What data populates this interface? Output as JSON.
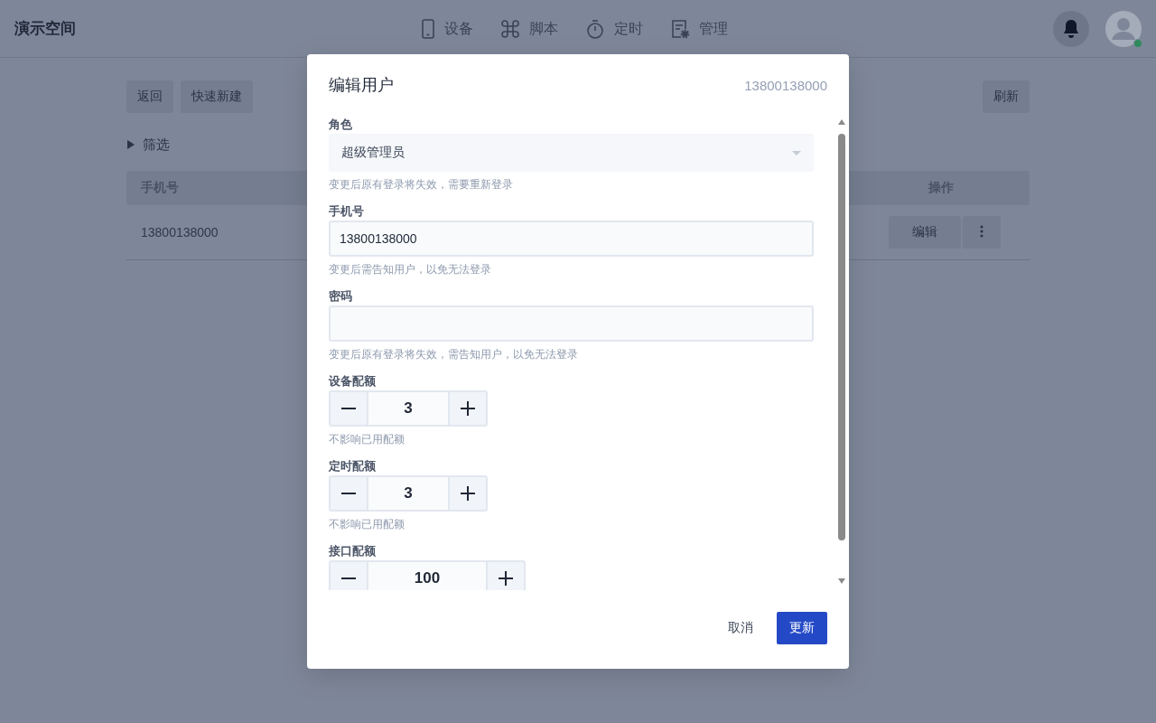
{
  "app_bar": {
    "title": "演示空间",
    "nav": [
      {
        "label": "设备"
      },
      {
        "label": "脚本"
      },
      {
        "label": "定时"
      },
      {
        "label": "管理"
      }
    ],
    "avatar": {
      "online": true
    }
  },
  "toolbar": {
    "left_buttons": [
      "返回",
      "快速新建"
    ],
    "right_buttons": [
      "刷新"
    ]
  },
  "filter": {
    "label": "筛选",
    "expanded": false
  },
  "table": {
    "columns": [
      "手机号",
      "操作"
    ],
    "rows": [
      {
        "phone": "13800138000",
        "edit": "编辑"
      }
    ]
  },
  "dialog": {
    "title": "编辑用户",
    "subtitle": "13800138000",
    "fields": [
      {
        "kind": "select",
        "label": "角色",
        "value": "超级管理员",
        "hint": "变更后原有登录将失效，需要重新登录"
      },
      {
        "kind": "text",
        "label": "手机号",
        "value": "13800138000",
        "hint": "变更后需告知用户，以免无法登录"
      },
      {
        "kind": "password",
        "label": "密码",
        "hint": "变更后原有登录将失效，需告知用户，以免无法登录"
      },
      {
        "kind": "stepper",
        "label": "设备配额",
        "value": "3",
        "hint": "不影响已用配额"
      },
      {
        "kind": "stepper",
        "label": "定时配额",
        "value": "3",
        "hint": "不影响已用配额"
      },
      {
        "kind": "stepper",
        "label": "接口配额",
        "value": "100"
      }
    ],
    "cancel": "取消",
    "confirm": "更新"
  }
}
